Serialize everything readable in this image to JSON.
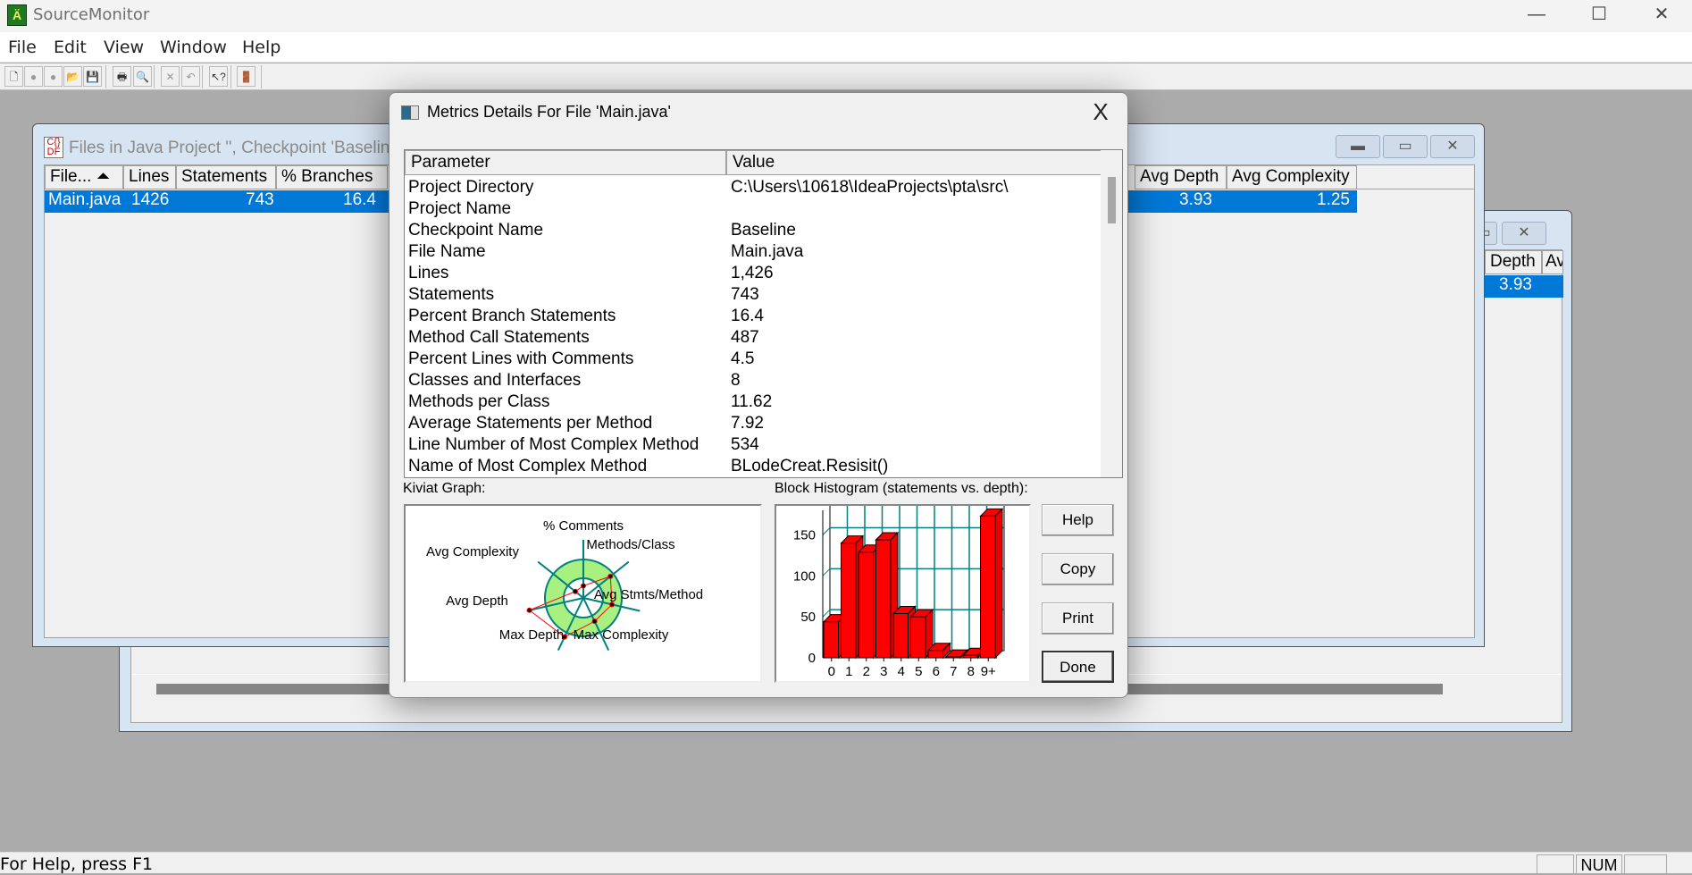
{
  "app": {
    "title": "SourceMonitor",
    "icon": "sourcemonitor-app-icon",
    "window_controls": {
      "minimize": "—",
      "maximize": "☐",
      "close": "✕"
    }
  },
  "menu": [
    "File",
    "Edit",
    "View",
    "Window",
    "Help"
  ],
  "toolbar": [
    {
      "name": "new-icon",
      "glyph": "🗋"
    },
    {
      "name": "record-icon",
      "glyph": "●"
    },
    {
      "name": "multi-record-icon",
      "glyph": "●"
    },
    {
      "name": "open-folder-icon",
      "glyph": "📂"
    },
    {
      "name": "save-icon",
      "glyph": "💾"
    },
    {
      "name": "print-icon",
      "glyph": "🖶"
    },
    {
      "name": "print-preview-icon",
      "glyph": "🔍"
    },
    {
      "name": "delete-icon",
      "glyph": "✕"
    },
    {
      "name": "undo-icon",
      "glyph": "↶"
    },
    {
      "name": "context-help-icon",
      "glyph": "↖?"
    },
    {
      "name": "exit-door-icon",
      "glyph": "🚪"
    }
  ],
  "files_window": {
    "title": "Files in Java Project '', Checkpoint 'Baseline'",
    "columns_left": [
      "File... ⏶",
      "Lines",
      "Statements",
      "% Branches"
    ],
    "columns_right": [
      "Avg Depth",
      "Avg Complexity"
    ],
    "row": {
      "file": "Main.java",
      "lines": "1426",
      "statements": "743",
      "branches": "16.4",
      "avg_depth": "3.93",
      "avg_complexity": "1.25"
    },
    "buttons": {
      "minimize": "▬",
      "restore": "▭",
      "close": "✕"
    }
  },
  "back_window": {
    "columns": [
      "Depth",
      "Av"
    ],
    "row": {
      "avg_depth": "3.93"
    }
  },
  "dialog": {
    "title": "Metrics Details For File 'Main.java'",
    "close": "X",
    "list_headers": {
      "parameter": "Parameter",
      "value": "Value"
    },
    "rows": [
      {
        "param": "Project Directory",
        "value": "C:\\Users\\10618\\IdeaProjects\\pta\\src\\"
      },
      {
        "param": "Project Name",
        "value": ""
      },
      {
        "param": "Checkpoint Name",
        "value": "Baseline"
      },
      {
        "param": "File Name",
        "value": "Main.java"
      },
      {
        "param": "Lines",
        "value": "1,426"
      },
      {
        "param": "Statements",
        "value": "743"
      },
      {
        "param": "Percent Branch Statements",
        "value": "16.4"
      },
      {
        "param": "Method Call Statements",
        "value": "487"
      },
      {
        "param": "Percent Lines with Comments",
        "value": "4.5"
      },
      {
        "param": "Classes and Interfaces",
        "value": "8"
      },
      {
        "param": "Methods per Class",
        "value": "11.62"
      },
      {
        "param": "Average Statements per Method",
        "value": "7.92"
      },
      {
        "param": "Line Number of Most Complex Method",
        "value": "534"
      },
      {
        "param": "Name of Most Complex Method",
        "value": "BLodeCreat.Resisit()"
      }
    ],
    "kiviat_label": "Kiviat Graph:",
    "histogram_label": "Block Histogram (statements vs. depth):",
    "buttons": {
      "help": "Help",
      "copy": "Copy",
      "print": "Print",
      "done": "Done"
    }
  },
  "chart_data": [
    {
      "type": "radar",
      "title": "Kiviat Graph",
      "axes": [
        "% Comments",
        "Methods/Class",
        "Avg Stmts/Method",
        "Max Complexity",
        "Max Depth",
        "Avg Depth",
        "Avg Complexity"
      ],
      "values_relative": [
        0.35,
        1.0,
        0.85,
        0.75,
        1.25,
        1.6,
        0.3
      ],
      "normal_range": [
        0.5,
        1.0
      ],
      "colors": {
        "band": "#a8f080",
        "band_edge": "#008080",
        "spokes": "#008080",
        "polygon": "#ff0000"
      }
    },
    {
      "type": "bar",
      "title": "Block Histogram (statements vs. depth)",
      "categories": [
        "0",
        "1",
        "2",
        "3",
        "4",
        "5",
        "6",
        "7",
        "8",
        "9+"
      ],
      "values": [
        44,
        140,
        129,
        144,
        54,
        50,
        9,
        1,
        3,
        173
      ],
      "yticks": [
        0,
        50,
        100,
        150
      ],
      "ylim": [
        0,
        180
      ],
      "grid": true,
      "colors": {
        "bar": "#ff0000",
        "grid": "#008080"
      }
    }
  ],
  "status": {
    "text": "For Help, press F1",
    "panes": [
      "",
      "NUM",
      ""
    ]
  }
}
